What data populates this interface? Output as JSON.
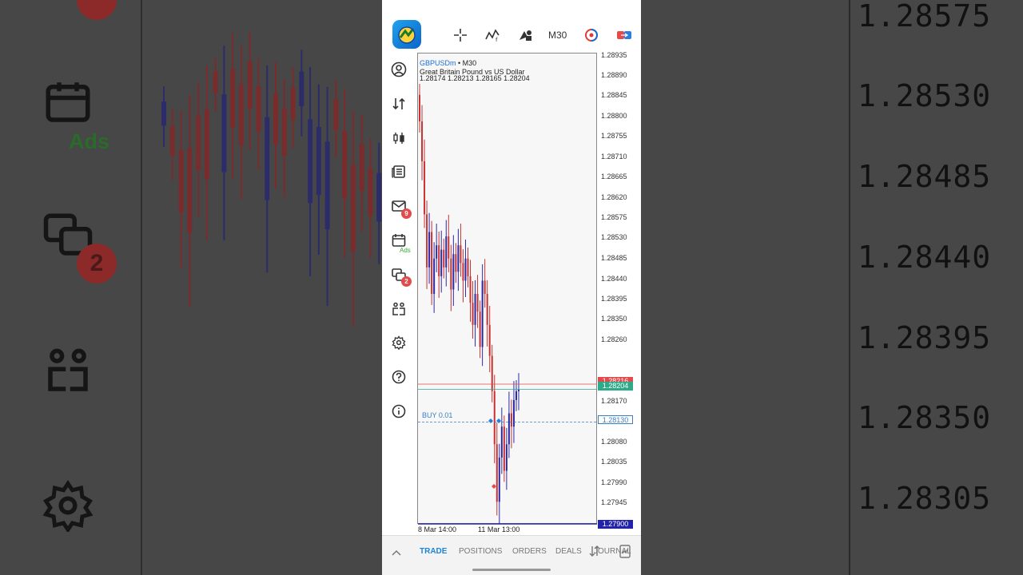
{
  "app": {
    "logo": "metatrader-logo-icon",
    "timeframe": "M30",
    "toolbar_icons": [
      "crosshair-icon",
      "indicators-icon",
      "objects-icon",
      "timeframe-label",
      "one-click-trading-icon",
      "trade-icon"
    ]
  },
  "sidebar": {
    "icons": [
      "account-icon",
      "quotes-icon",
      "chart-icon",
      "history-icon",
      "mail-icon",
      "calendar-icon",
      "chat-icon",
      "community-icon",
      "settings-icon",
      "help-icon",
      "about-icon"
    ],
    "mail_badge": "9",
    "chat_badge": "2",
    "ads_label": "Ads"
  },
  "chart": {
    "symbol": "GBPUSDm",
    "separator": " • ",
    "timeframe": "M30",
    "description": "Great Britain Pound vs US Dollar",
    "ohlc": "1.28174 1.28213 1.28165 1.28204",
    "y_ticks": [
      "1.28935",
      "1.28890",
      "1.28845",
      "1.28800",
      "1.28755",
      "1.28710",
      "1.28665",
      "1.28620",
      "1.28575",
      "1.28530",
      "1.28485",
      "1.28440",
      "1.28395",
      "1.28350",
      "1.28260",
      "1.28170",
      "1.28080",
      "1.28035",
      "1.27990",
      "1.27945"
    ],
    "x_ticks": [
      "8 Mar 14:00",
      "11 Mar 13:00"
    ],
    "ask_price": "1.28216",
    "bid_price": "1.28204",
    "position_price": "1.28130",
    "low_price": "1.27900",
    "position_label": "BUY 0.01",
    "colors": {
      "up": "#2a2aa8",
      "down": "#c83232",
      "ask": "#e34b4b",
      "bid": "#2eaa8a",
      "low": "#2222aa"
    }
  },
  "chart_data": {
    "type": "candlestick",
    "symbol": "GBPUSDm",
    "timeframe": "M30",
    "ylim": [
      1.279,
      1.2896
    ],
    "bid": 1.28204,
    "ask": 1.28216,
    "position": {
      "side": "BUY",
      "volume": 0.01,
      "price": 1.2813
    },
    "close_series": [
      1.2881,
      1.2872,
      1.286,
      1.2848,
      1.2856,
      1.2842,
      1.285,
      1.2853,
      1.2846,
      1.2852,
      1.2848,
      1.2855,
      1.285,
      1.2843,
      1.2851,
      1.2847,
      1.2853,
      1.2849,
      1.2845,
      1.285,
      1.2846,
      1.284,
      1.2835,
      1.2842,
      1.2838,
      1.283,
      1.2845,
      1.2842,
      1.2835,
      1.2828,
      1.282,
      1.2808,
      1.2795,
      1.2805,
      1.2812,
      1.2802,
      1.2808,
      1.2815,
      1.2812,
      1.2818,
      1.282,
      1.28204
    ]
  },
  "tabs": [
    "TRADE",
    "POSITIONS",
    "ORDERS",
    "DEALS",
    "JOURNAL"
  ],
  "background": {
    "right_ticks": [
      "1.28575",
      "1.28530",
      "1.28485",
      "1.28440",
      "1.28395",
      "1.28350",
      "1.28305"
    ],
    "left_badge": "2",
    "left_ads": "Ads"
  }
}
